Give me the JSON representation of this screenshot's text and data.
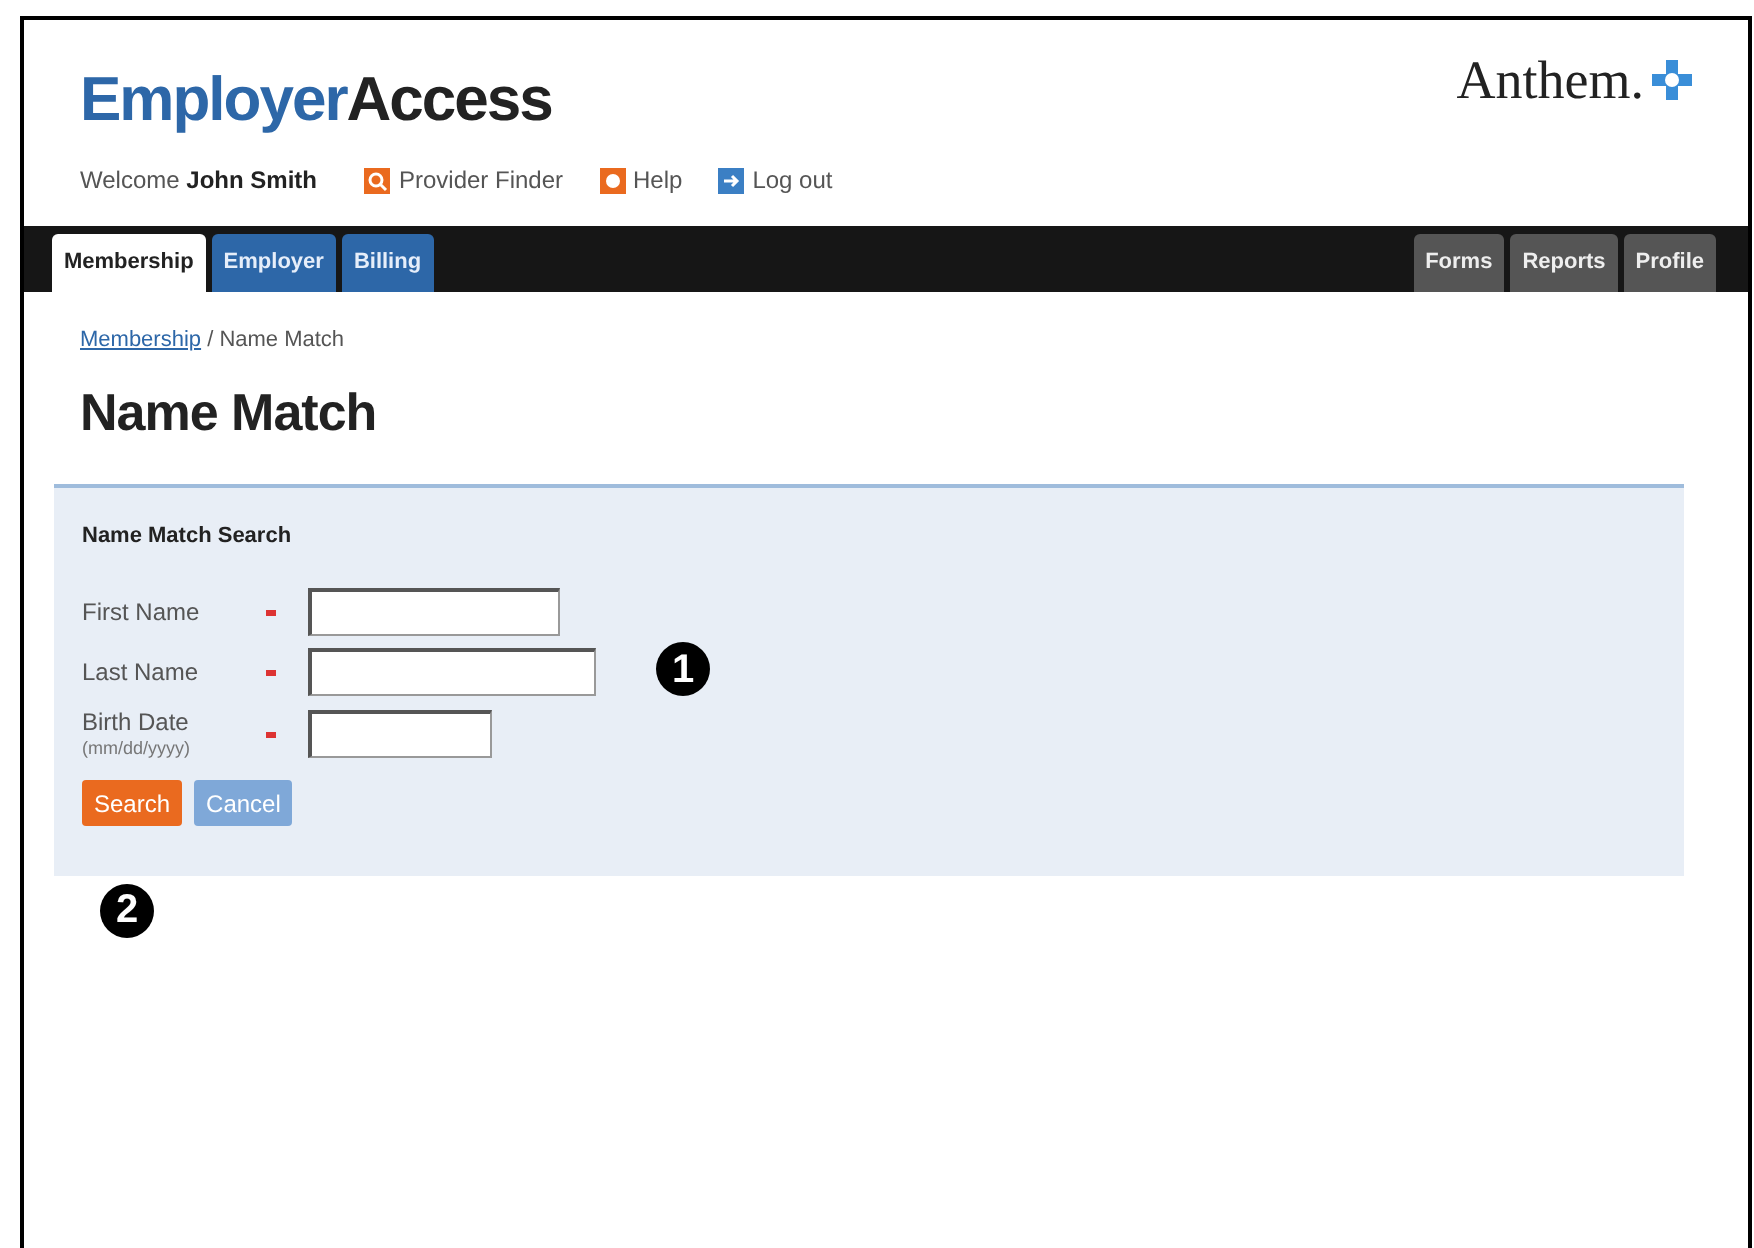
{
  "header": {
    "logo_primary": "Employer",
    "logo_secondary": "Access",
    "brand": "Anthem.",
    "welcome": "Welcome",
    "user": "John Smith",
    "links": [
      {
        "label": "Provider Finder",
        "kind": "search"
      },
      {
        "label": "Help",
        "kind": "help"
      },
      {
        "label": "Log out",
        "kind": "logout"
      }
    ]
  },
  "tabs_left": [
    {
      "label": "Membership",
      "selected": true
    },
    {
      "label": "Employer",
      "selected": false
    },
    {
      "label": "Billing",
      "selected": false
    }
  ],
  "tabs_right": [
    {
      "label": "Forms",
      "selected": false
    },
    {
      "label": "Reports",
      "selected": false
    },
    {
      "label": "Profile",
      "selected": false
    }
  ],
  "breadcrumb": {
    "link": "Membership",
    "current": " / Name Match"
  },
  "page_title": "Name Match",
  "panel": {
    "title": "Name Match Search",
    "fields": [
      {
        "label": "First Name",
        "required": true
      },
      {
        "label": "Last Name",
        "required": true
      },
      {
        "label": "Birth Date",
        "hint": "(mm/dd/yyyy)",
        "required": true
      }
    ],
    "buttons": [
      {
        "label": "Search",
        "kind": "primary"
      },
      {
        "label": "Cancel",
        "kind": "secondary"
      }
    ]
  },
  "callouts": [
    "1",
    "2"
  ]
}
